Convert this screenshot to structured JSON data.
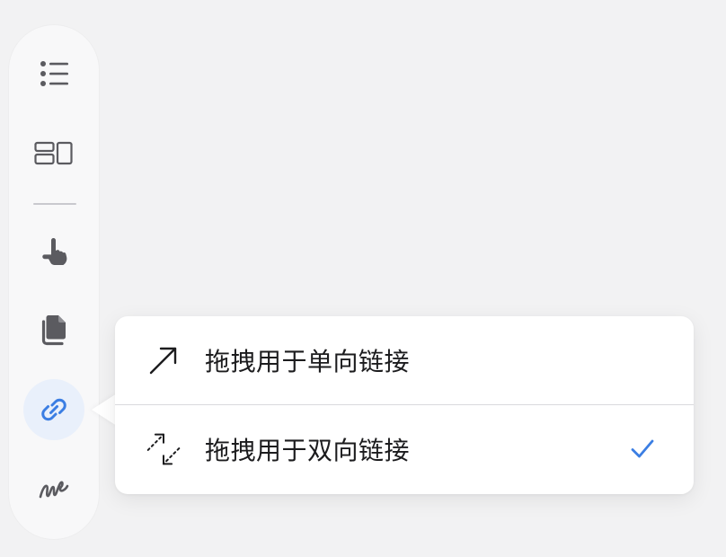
{
  "toolbar": {
    "items": [
      {
        "name": "list",
        "icon": "list-icon"
      },
      {
        "name": "layout",
        "icon": "layout-icon"
      },
      {
        "name": "pointer",
        "icon": "hand-pointer-icon"
      },
      {
        "name": "copy",
        "icon": "documents-icon"
      },
      {
        "name": "link",
        "icon": "link-icon",
        "active": true
      },
      {
        "name": "draw",
        "icon": "scribble-icon"
      }
    ]
  },
  "link_menu": {
    "items": [
      {
        "label": "拖拽用于单向链接",
        "icon": "arrow-up-right-icon",
        "selected": false
      },
      {
        "label": "拖拽用于双向链接",
        "icon": "bidirectional-arrow-icon",
        "selected": true
      }
    ]
  },
  "colors": {
    "accent": "#3b7ee3",
    "icon": "#5b5b60",
    "background": "#f2f2f3"
  }
}
